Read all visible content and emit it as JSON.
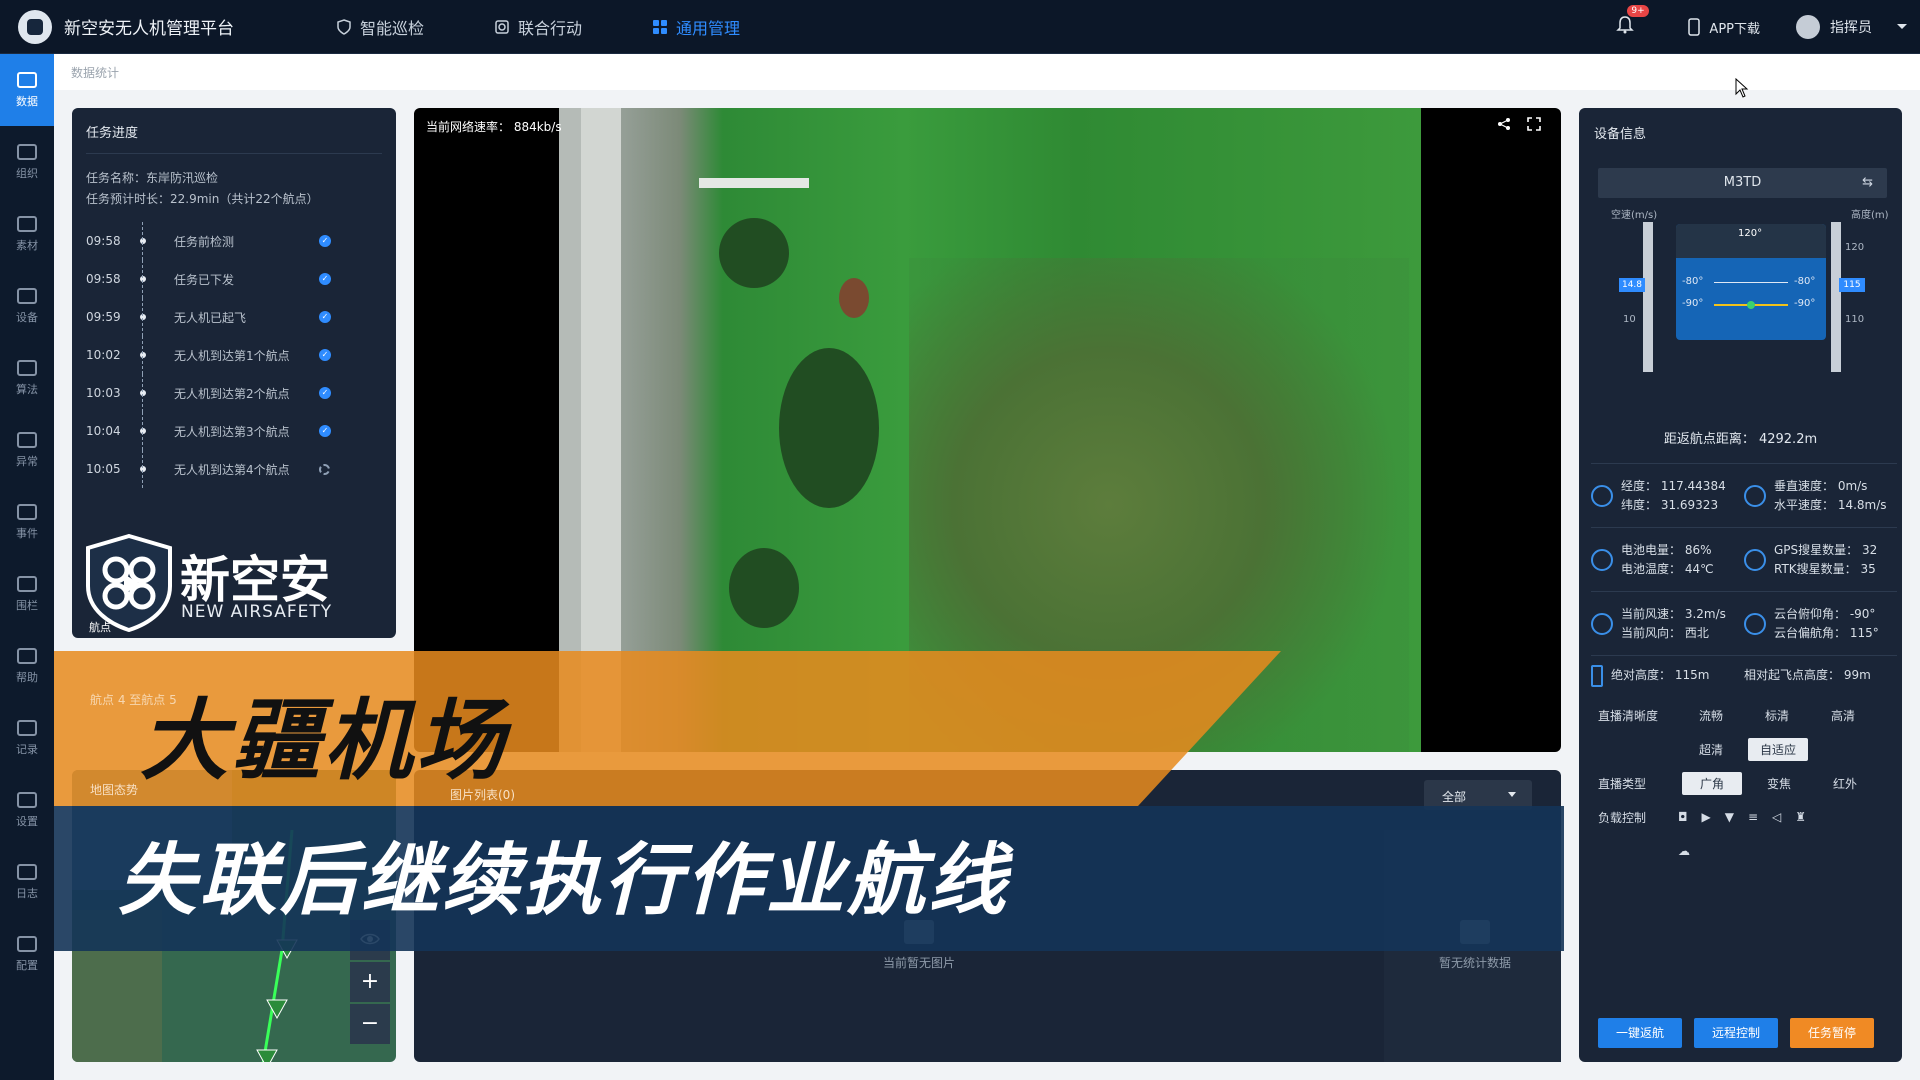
{
  "app": {
    "title": "新空安无人机管理平台"
  },
  "nav": [
    {
      "label": "智能巡检",
      "icon": "shield-icon"
    },
    {
      "label": "联合行动",
      "icon": "target-icon"
    },
    {
      "label": "通用管理",
      "icon": "grid-icon",
      "active": true
    }
  ],
  "header_right": {
    "bell_badge": "9+",
    "app_download": "APP下载",
    "user": "指挥员"
  },
  "sidebar": [
    {
      "label": "数据",
      "active": true
    },
    {
      "label": "组织"
    },
    {
      "label": "素材"
    },
    {
      "label": "设备"
    },
    {
      "label": "算法"
    },
    {
      "label": "异常"
    },
    {
      "label": "事件"
    },
    {
      "label": "围栏"
    },
    {
      "label": "帮助"
    },
    {
      "label": "记录"
    },
    {
      "label": "设置"
    },
    {
      "label": "日志"
    },
    {
      "label": "配置"
    }
  ],
  "breadcrumb": "数据统计",
  "task": {
    "title": "任务进度",
    "name": "任务名称：东岸防汛巡检",
    "duration": "任务预计时长：22.9min（共计22个航点）",
    "timeline": [
      {
        "time": "09:58",
        "label": "任务前检测",
        "done": true
      },
      {
        "time": "09:58",
        "label": "任务已下发",
        "done": true
      },
      {
        "time": "09:59",
        "label": "无人机已起飞",
        "done": true
      },
      {
        "time": "10:02",
        "label": "无人机到达第1个航点",
        "done": true
      },
      {
        "time": "10:03",
        "label": "无人机到达第2个航点",
        "done": true
      },
      {
        "time": "10:04",
        "label": "无人机到达第3个航点",
        "done": true
      },
      {
        "time": "10:05",
        "label": "无人机到达第4个航点",
        "done": false
      }
    ],
    "segment": "航点 4 至航点 5"
  },
  "watermark": {
    "name": "新空安",
    "en": "NEW AIRSAFETY",
    "mark": "航点"
  },
  "video": {
    "net_rate": "当前网络速率： 884kb/s"
  },
  "map": {
    "title": "地图态势",
    "zoom_in": "+",
    "zoom_out": "−"
  },
  "photos": {
    "title": "图片列表(0)",
    "filter": "全部",
    "empty_photos": "当前暂无图片",
    "empty_stats": "暂无统计数据"
  },
  "device": {
    "title": "设备信息",
    "model": "M3TD",
    "airspeed_label": "空速(m/s)",
    "altitude_label": "高度(m)",
    "airspeed_value": "14.8",
    "altitude_value": "115",
    "alt_ticks": [
      "120",
      "110"
    ],
    "speed_ticks": [
      "10"
    ],
    "pitch_ticks": [
      "-80°",
      "-80°",
      "-90°",
      "-90°"
    ],
    "heading_label": "120°",
    "return_distance": "距返航点距离： 4292.2m",
    "metrics": [
      {
        "icon": "globe-icon",
        "line1": "经度： 117.44384",
        "line2": "纬度： 31.69323"
      },
      {
        "icon": "speed-icon",
        "line1": "垂直速度： 0m/s",
        "line2": "水平速度： 14.8m/s"
      },
      {
        "icon": "battery-icon",
        "line1": "电池电量： 86%",
        "line2": "电池温度： 44℃"
      },
      {
        "icon": "signal-icon",
        "line1": "GPS搜星数量： 32",
        "line2": "RTK搜星数量： 35"
      },
      {
        "icon": "wind-icon",
        "line1": "当前风速： 3.2m/s",
        "line2": "当前风向： 西北"
      },
      {
        "icon": "gimbal-icon",
        "line1": "云台俯仰角： -90°",
        "line2": "云台偏航角： 115°"
      }
    ],
    "abs_height": "绝对高度： 115m",
    "rel_height": "相对起飞点高度： 99m",
    "clarity_label": "直播清晰度",
    "clarity": [
      "流畅",
      "标清",
      "高清",
      "超清",
      "自适应"
    ],
    "clarity_selected": "自适应",
    "stream_label": "直播类型",
    "stream": [
      "广角",
      "变焦",
      "红外"
    ],
    "stream_selected": "广角",
    "payload_label": "负载控制",
    "buttons": {
      "return": "一键返航",
      "remote": "远程控制",
      "pause": "任务暂停"
    }
  },
  "overlay": {
    "line1": "大疆机场",
    "line2": "失联后继续执行作业航线"
  },
  "colors": {
    "accent": "#2f8cff",
    "orange": "#f08a24",
    "panel": "#1a2537",
    "topbar": "#0c1728"
  }
}
